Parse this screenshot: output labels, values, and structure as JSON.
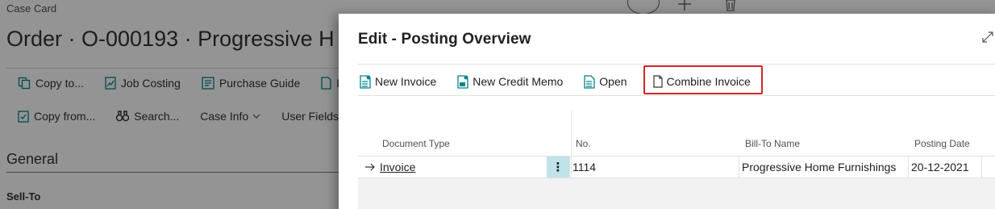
{
  "background": {
    "breadcrumb": "Case Card",
    "title": "Order · O-000193 · Progressive H",
    "actions_row1": [
      {
        "label": "Copy to...",
        "icon": "copy-to-icon"
      },
      {
        "label": "Job Costing",
        "icon": "job-costing-icon"
      },
      {
        "label": "Purchase Guide",
        "icon": "purchase-guide-icon"
      },
      {
        "label": "In",
        "icon": "document-icon"
      }
    ],
    "actions_row2": [
      {
        "label": "Copy from...",
        "icon": "copy-from-icon"
      },
      {
        "label": "Search...",
        "icon": "binoculars-icon"
      },
      {
        "label": "Case Info",
        "icon": "chevron-down-icon"
      },
      {
        "label": "User Fields",
        "icon": "chevron-down-icon"
      }
    ],
    "section_general": "General",
    "field_sell_to": "Sell-To"
  },
  "dialog": {
    "title": "Edit - Posting Overview",
    "toolbar": {
      "new_invoice": "New Invoice",
      "new_credit_memo": "New Credit Memo",
      "open": "Open",
      "combine_invoice": "Combine Invoice"
    },
    "table": {
      "headers": {
        "document_type": "Document Type",
        "no": "No.",
        "bill_to_name": "Bill-To Name",
        "posting_date": "Posting Date"
      },
      "rows": [
        {
          "document_type": "Invoice",
          "no": "1114",
          "bill_to_name": "Progressive Home Furnishings",
          "posting_date": "20-12-2021"
        }
      ]
    }
  },
  "colors": {
    "accent_teal": "#008489",
    "highlight_red": "#d0262b",
    "row_menu_bg": "#bfe3ea"
  }
}
